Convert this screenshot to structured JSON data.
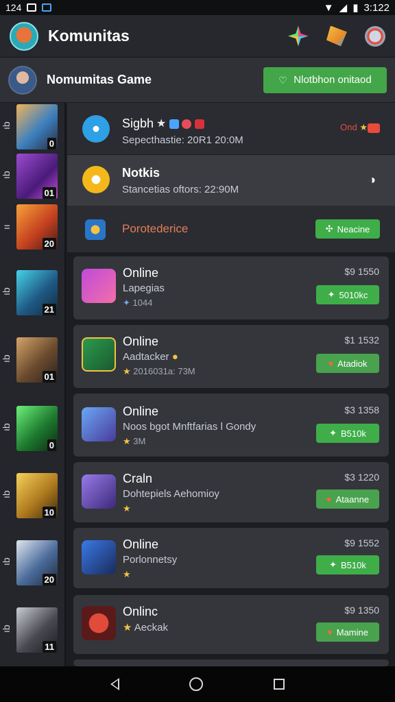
{
  "status_bar": {
    "left_text": "124",
    "time": "3:122"
  },
  "app_bar": {
    "title": "Komunitas"
  },
  "community": {
    "name": "Nomumitas Game",
    "button_label": "Nlotbhon onitaod"
  },
  "rail": [
    {
      "mark": "ıb",
      "count": "0"
    },
    {
      "mark": "ıb",
      "count": "01"
    },
    {
      "mark": "ıı",
      "count": "20"
    },
    {
      "mark": "ıb",
      "count": "21"
    },
    {
      "mark": "ıb",
      "count": "01"
    },
    {
      "mark": "ıb",
      "count": "0"
    },
    {
      "mark": "ıb",
      "count": "10"
    },
    {
      "mark": "ıb",
      "count": "20"
    },
    {
      "mark": "ıb",
      "count": "11"
    }
  ],
  "rows_flat": [
    {
      "title": "Sigbh",
      "sub": "Sepecthastie: 20R1  20:0M",
      "right": "Ond"
    },
    {
      "title": "Notkis",
      "sub": "Stancetias oftors: 22:90M"
    },
    {
      "title": "Porotederice",
      "button": "Neacine"
    }
  ],
  "rows_card": [
    {
      "title": "Online",
      "sub": "Lapegias",
      "meta": "1044",
      "price": "$9 1550",
      "button": "5010kc",
      "style": "green"
    },
    {
      "title": "Online",
      "sub": "Aadtacker",
      "meta": "2016031a: 73M",
      "price": "$1 1532",
      "button": "Atadiok",
      "style": "orange"
    },
    {
      "title": "Online",
      "sub": "Noos bgot Mnftfarias l Gondy",
      "meta": "3M",
      "price": "$3 1358",
      "button": "B510k",
      "style": "green"
    },
    {
      "title": "Craln",
      "sub": "Dohtepiels Aehomioy",
      "meta": "",
      "price": "$3 1220",
      "button": "Ataanne",
      "style": "orange"
    },
    {
      "title": "Online",
      "sub": "Porlonnetsy",
      "meta": "",
      "price": "$9 1552",
      "button": "B510k",
      "style": "green"
    },
    {
      "title": "Onlinc",
      "sub": "Aeckak",
      "meta": "",
      "price": "$9 1350",
      "button": "Mamine",
      "style": "orange"
    }
  ]
}
